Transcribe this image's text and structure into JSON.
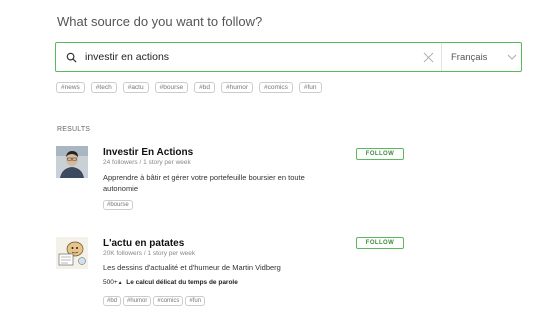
{
  "heading": "What source do you want to follow?",
  "search": {
    "value": "investir en actions"
  },
  "language": {
    "selected": "Français"
  },
  "topic_tags": [
    "#news",
    "#tech",
    "#actu",
    "#bourse",
    "#bd",
    "#humor",
    "#comics",
    "#fun"
  ],
  "results_label": "RESULTS",
  "results": [
    {
      "title": "Investir En Actions",
      "meta": "24 followers / 1 story per week",
      "description": "Apprendre à bâtir et gérer votre portefeuille boursier en toute autonomie",
      "tags": [
        "#bourse"
      ],
      "follow_label": "FOLLOW"
    },
    {
      "title": "L'actu en patates",
      "meta": "20K followers / 1 story per week",
      "description": "Les dessins d'actualité et d'humeur de Martin Vidberg",
      "note_count": "500+",
      "note_text": "Le calcul délicat du temps de parole",
      "tags": [
        "#bd",
        "#humor",
        "#comics",
        "#fun"
      ],
      "follow_label": "FOLLOW"
    }
  ],
  "colors": {
    "accent": "#5cb85c"
  }
}
